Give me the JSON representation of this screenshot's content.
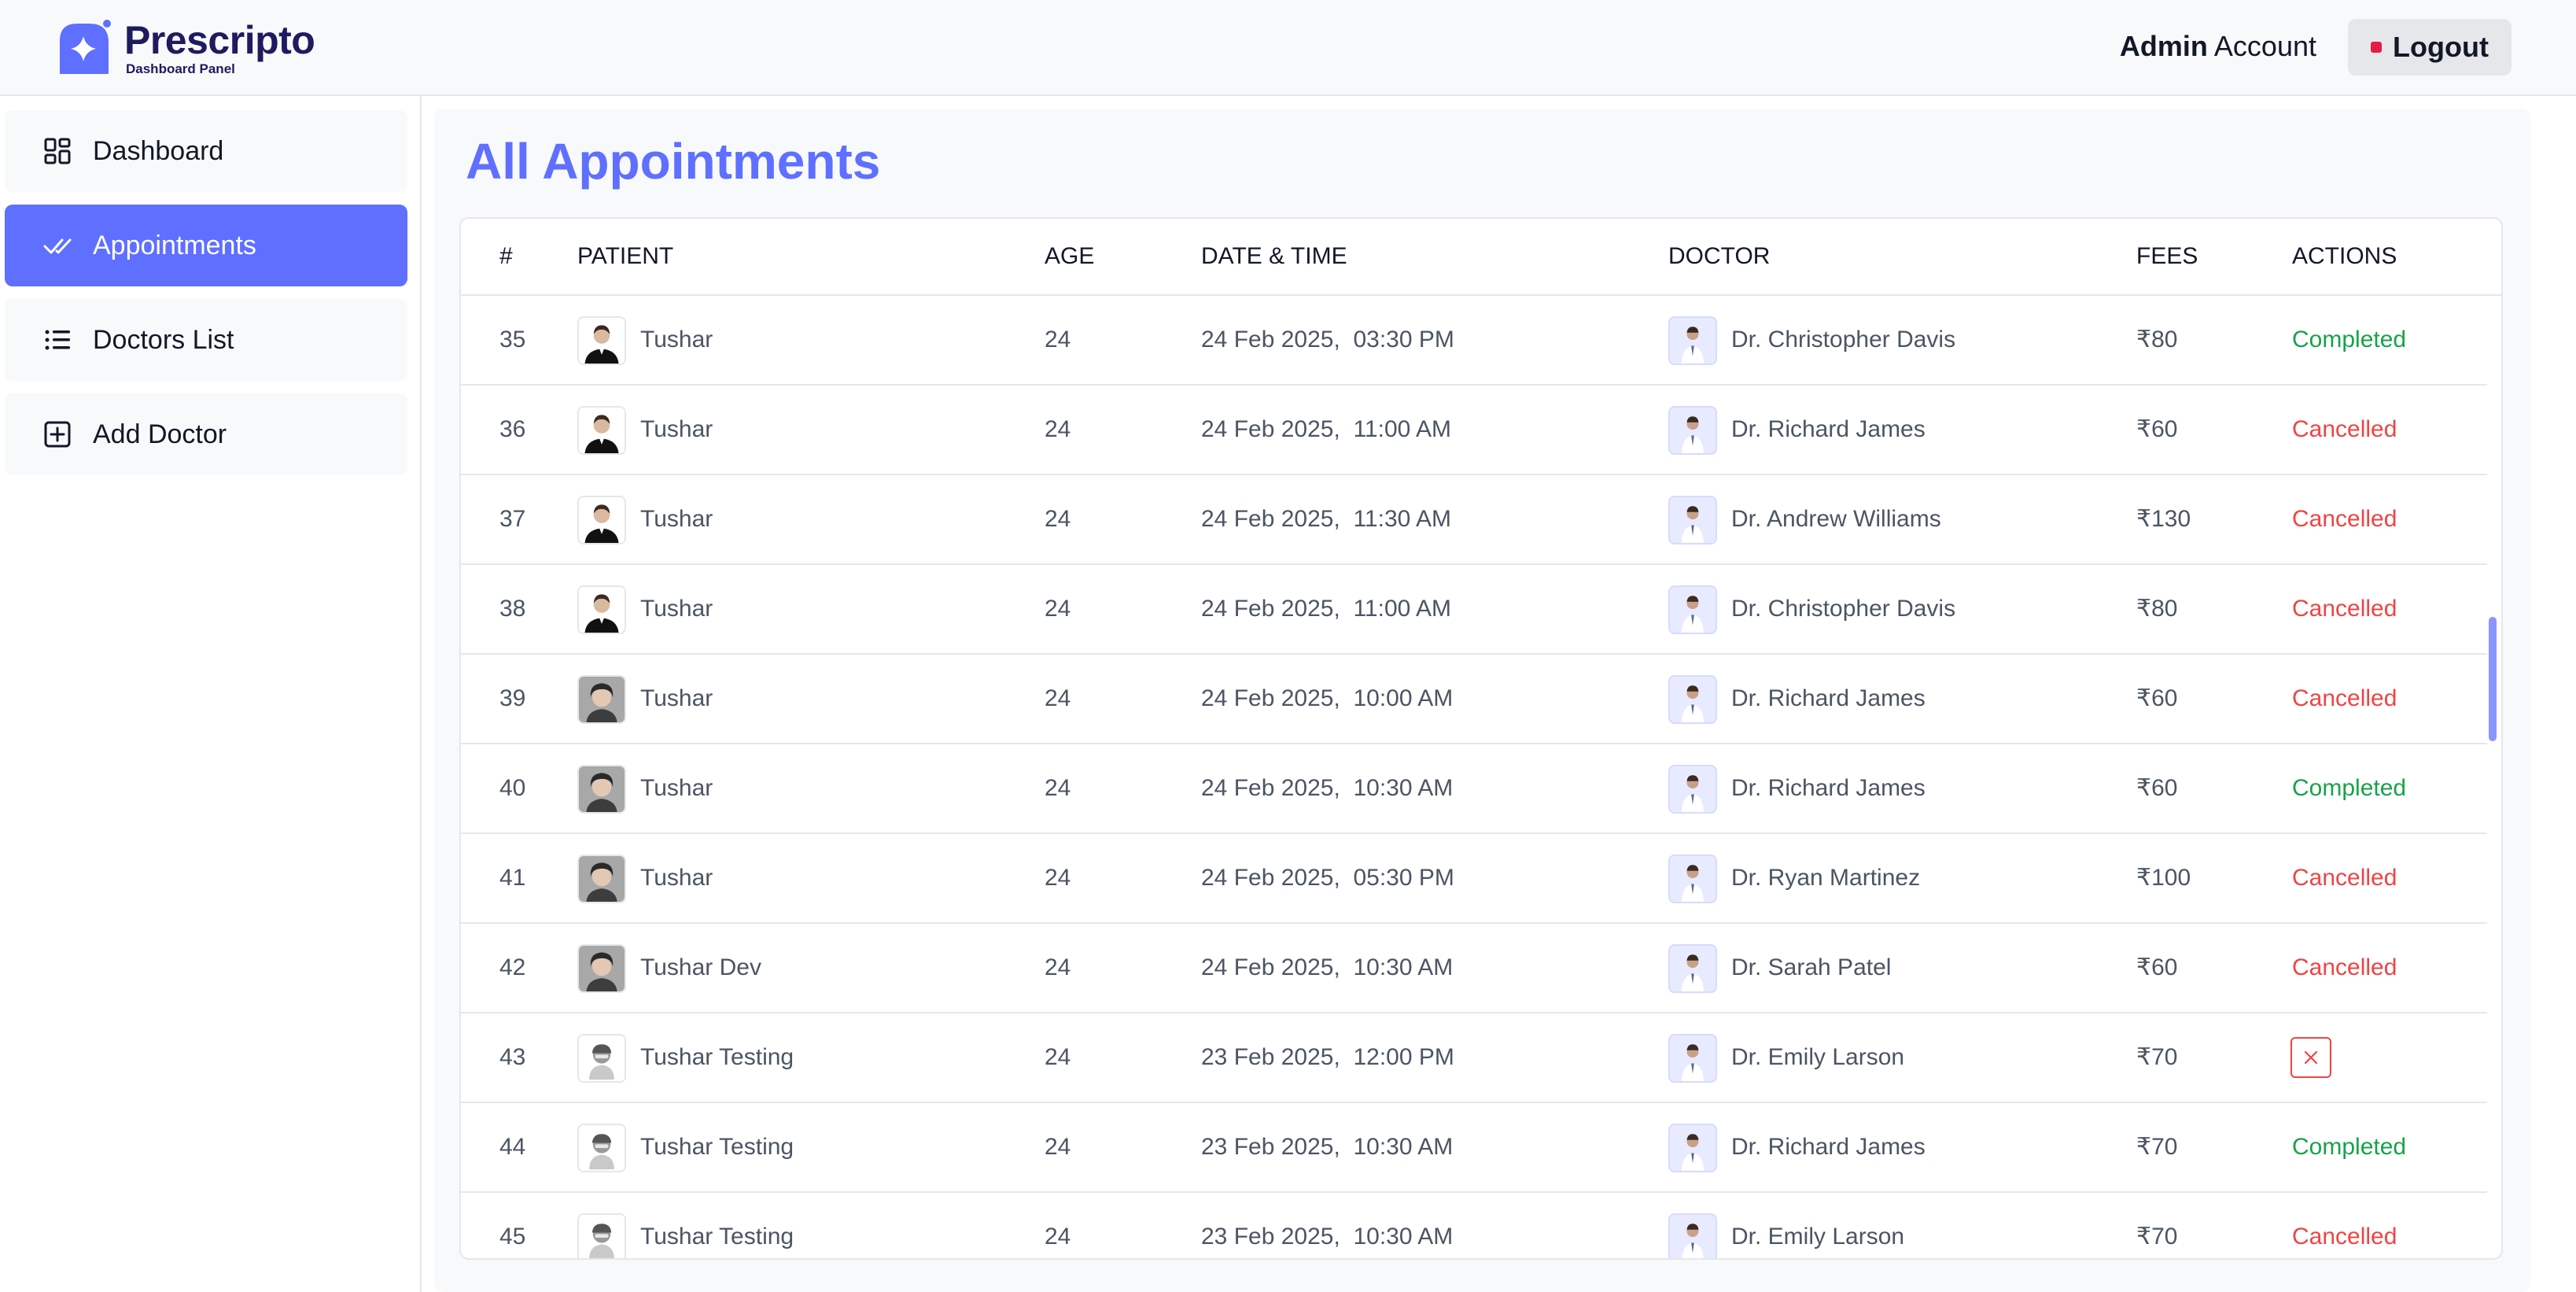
{
  "header": {
    "brand_name": "Prescripto",
    "brand_sub": "Dashboard Panel",
    "account_bold": "Admin",
    "account_rest": "Account",
    "logout_label": "Logout"
  },
  "sidebar": {
    "items": [
      {
        "label": "Dashboard",
        "icon": "dashboard-icon",
        "active": false
      },
      {
        "label": "Appointments",
        "icon": "check-icon",
        "active": true
      },
      {
        "label": "Doctors List",
        "icon": "list-icon",
        "active": false
      },
      {
        "label": "Add Doctor",
        "icon": "plus-square-icon",
        "active": false
      }
    ]
  },
  "main": {
    "title": "All Appointments",
    "columns": [
      "#",
      "PATIENT",
      "AGE",
      "DATE & TIME",
      "DOCTOR",
      "FEES",
      "ACTIONS"
    ],
    "rows": [
      {
        "num": "35",
        "patient": "Tushar",
        "age": "24",
        "datetime": "24 Feb 2025,  03:30 PM",
        "doctor": "Dr. Christopher Davis",
        "fees": "₹80",
        "action": "Completed",
        "patient_avatar": "photo-a"
      },
      {
        "num": "36",
        "patient": "Tushar",
        "age": "24",
        "datetime": "24 Feb 2025,  11:00 AM",
        "doctor": "Dr. Richard James",
        "fees": "₹60",
        "action": "Cancelled",
        "patient_avatar": "photo-a"
      },
      {
        "num": "37",
        "patient": "Tushar",
        "age": "24",
        "datetime": "24 Feb 2025,  11:30 AM",
        "doctor": "Dr. Andrew Williams",
        "fees": "₹130",
        "action": "Cancelled",
        "patient_avatar": "photo-a"
      },
      {
        "num": "38",
        "patient": "Tushar",
        "age": "24",
        "datetime": "24 Feb 2025,  11:00 AM",
        "doctor": "Dr. Christopher Davis",
        "fees": "₹80",
        "action": "Cancelled",
        "patient_avatar": "photo-a"
      },
      {
        "num": "39",
        "patient": "Tushar",
        "age": "24",
        "datetime": "24 Feb 2025,  10:00 AM",
        "doctor": "Dr. Richard James",
        "fees": "₹60",
        "action": "Cancelled",
        "patient_avatar": "photo-b"
      },
      {
        "num": "40",
        "patient": "Tushar",
        "age": "24",
        "datetime": "24 Feb 2025,  10:30 AM",
        "doctor": "Dr. Richard James",
        "fees": "₹60",
        "action": "Completed",
        "patient_avatar": "photo-b"
      },
      {
        "num": "41",
        "patient": "Tushar",
        "age": "24",
        "datetime": "24 Feb 2025,  05:30 PM",
        "doctor": "Dr. Ryan Martinez",
        "fees": "₹100",
        "action": "Cancelled",
        "patient_avatar": "photo-b"
      },
      {
        "num": "42",
        "patient": "Tushar Dev",
        "age": "24",
        "datetime": "24 Feb 2025,  10:30 AM",
        "doctor": "Dr. Sarah Patel",
        "fees": "₹60",
        "action": "Cancelled",
        "patient_avatar": "photo-b"
      },
      {
        "num": "43",
        "patient": "Tushar Testing",
        "age": "24",
        "datetime": "23 Feb 2025,  12:00 PM",
        "doctor": "Dr. Emily Larson",
        "fees": "₹70",
        "action": "cancel-button",
        "patient_avatar": "photo-c"
      },
      {
        "num": "44",
        "patient": "Tushar Testing",
        "age": "24",
        "datetime": "23 Feb 2025,  10:30 AM",
        "doctor": "Dr. Richard James",
        "fees": "₹70",
        "action": "Completed",
        "patient_avatar": "photo-c"
      },
      {
        "num": "45",
        "patient": "Tushar Testing",
        "age": "24",
        "datetime": "23 Feb 2025,  10:30 AM",
        "doctor": "Dr. Emily Larson",
        "fees": "₹70",
        "action": "Cancelled",
        "patient_avatar": "photo-c"
      }
    ]
  },
  "colors": {
    "accent": "#5f6fff",
    "completed": "#16a34a",
    "cancelled": "#ef4444",
    "brand": "#1e1b5e"
  }
}
